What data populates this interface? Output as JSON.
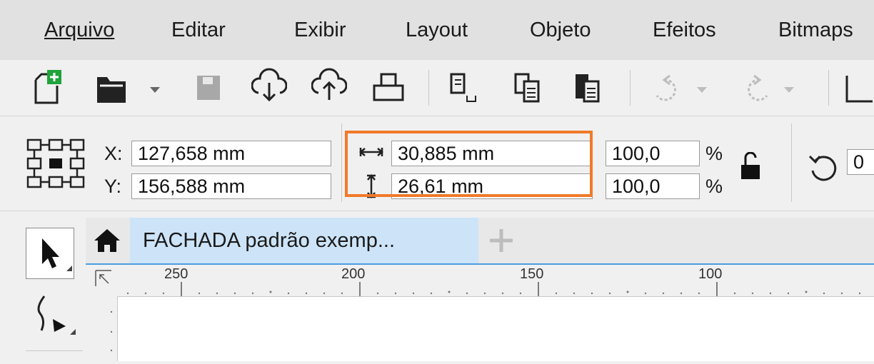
{
  "menu": {
    "items": [
      {
        "label": "Arquivo"
      },
      {
        "label": "Editar"
      },
      {
        "label": "Exibir"
      },
      {
        "label": "Layout"
      },
      {
        "label": "Objeto"
      },
      {
        "label": "Efeitos"
      },
      {
        "label": "Bitmaps"
      }
    ]
  },
  "toolbar": {
    "icons": [
      "new-document-icon",
      "open-icon",
      "dropdown-icon",
      "save-icon",
      "import-icon",
      "export-icon",
      "print-icon",
      "copy-format-icon",
      "copy-icon",
      "paste-icon",
      "undo-icon",
      "redo-icon"
    ]
  },
  "propbar": {
    "x_label": "X:",
    "x_value": "127,658 mm",
    "y_label": "Y:",
    "y_value": "156,588 mm",
    "width_value": "30,885 mm",
    "height_value": "26,61 mm",
    "scale_x": "100,0",
    "scale_y": "100,0",
    "percent_x": "%",
    "percent_y": "%",
    "rotation_partial": "0"
  },
  "tabs": {
    "document_tab": "FACHADA padrão exemp..."
  },
  "ruler": {
    "ticks": [
      "250",
      "200",
      "150",
      "100"
    ]
  },
  "colors": {
    "highlight": "#f07a2a",
    "tab_active": "#cde4f8",
    "tab_underline": "#4a9de0"
  }
}
